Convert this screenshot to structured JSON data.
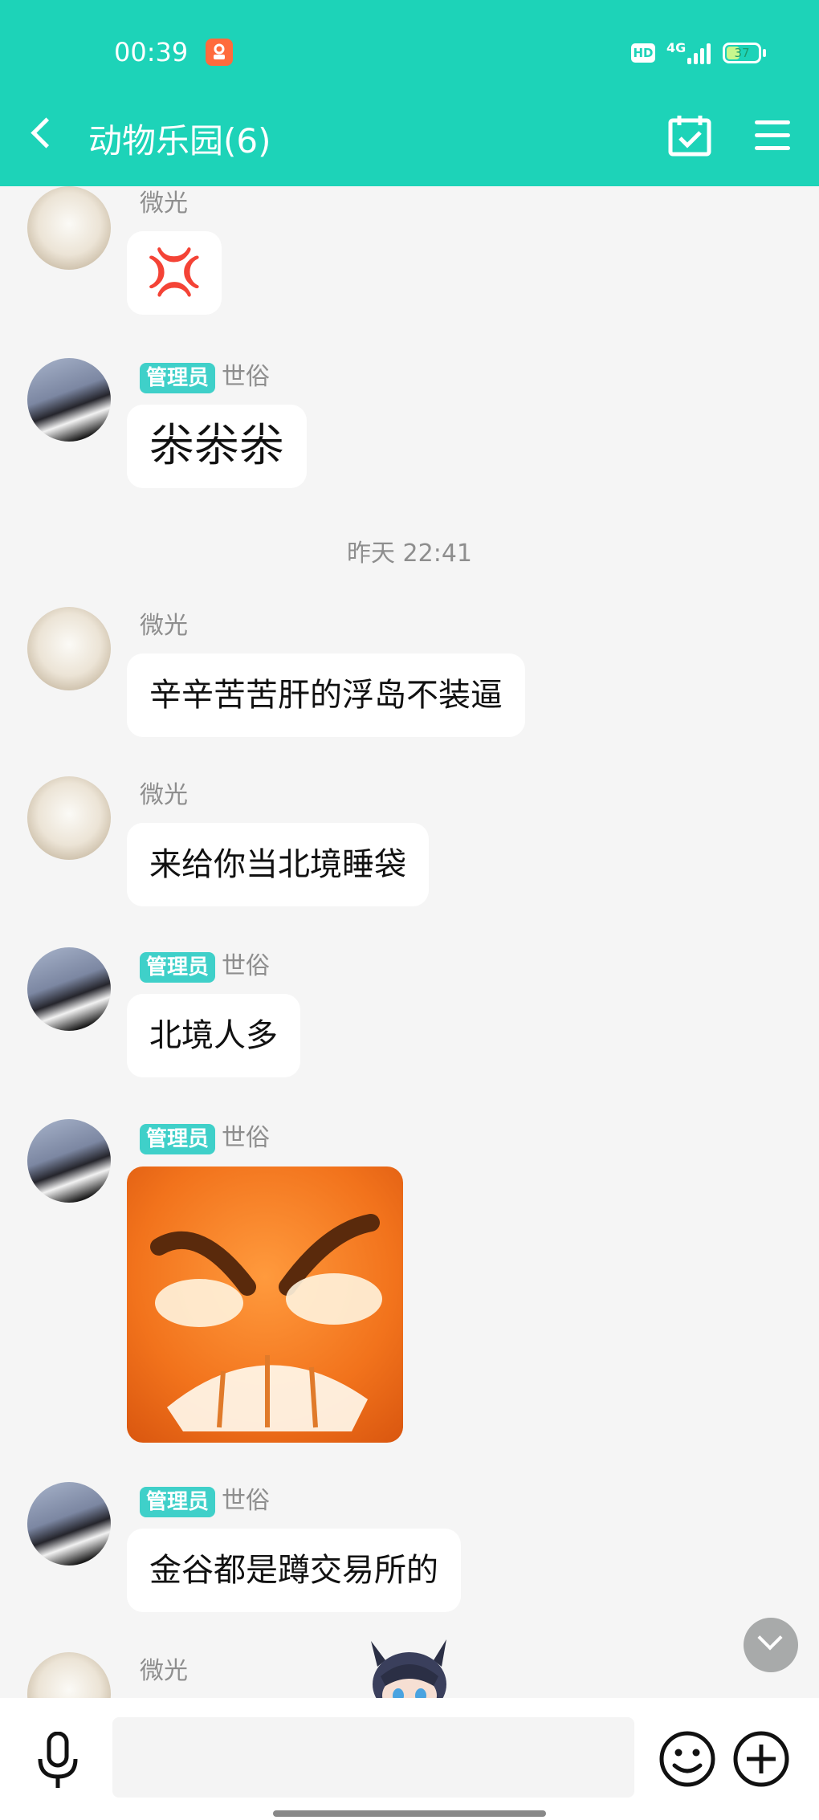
{
  "status_bar": {
    "time": "00:39",
    "network": "4G",
    "hd": "HD",
    "battery": "37"
  },
  "header": {
    "title": "动物乐园(6)",
    "back_icon": "chevron-left-icon",
    "calendar_icon": "calendar-check-icon",
    "menu_icon": "hamburger-menu-icon"
  },
  "chat": {
    "admin_badge": "管理员",
    "time_separator": "昨天 22:41",
    "messages": [
      {
        "sender": "微光",
        "admin": false,
        "type": "sticker",
        "content": "anger-symbol-emoji",
        "glyph": "💢"
      },
      {
        "sender": "世俗",
        "admin": true,
        "type": "text",
        "content": "尜尜尜"
      },
      {
        "sender": "微光",
        "admin": false,
        "type": "text",
        "content": "辛辛苦苦肝的浮岛不装逼"
      },
      {
        "sender": "微光",
        "admin": false,
        "type": "text",
        "content": "来给你当北境睡袋"
      },
      {
        "sender": "世俗",
        "admin": true,
        "type": "text",
        "content": "北境人多"
      },
      {
        "sender": "世俗",
        "admin": true,
        "type": "sticker",
        "content": "angry-orange-face-sticker"
      },
      {
        "sender": "世俗",
        "admin": true,
        "type": "text",
        "content": "金谷都是蹲交易所的"
      },
      {
        "sender": "微光",
        "admin": false,
        "type": "partial",
        "content": ""
      }
    ]
  },
  "input_bar": {
    "placeholder": "",
    "value": "",
    "mic_icon": "microphone-icon",
    "emoji_icon": "smiley-face-icon",
    "plus_icon": "plus-circle-icon"
  },
  "colors": {
    "header": "#1dd3b8",
    "admin_badge": "#3fd0c9",
    "bubble": "#ffffff",
    "background": "#f5f5f5"
  }
}
